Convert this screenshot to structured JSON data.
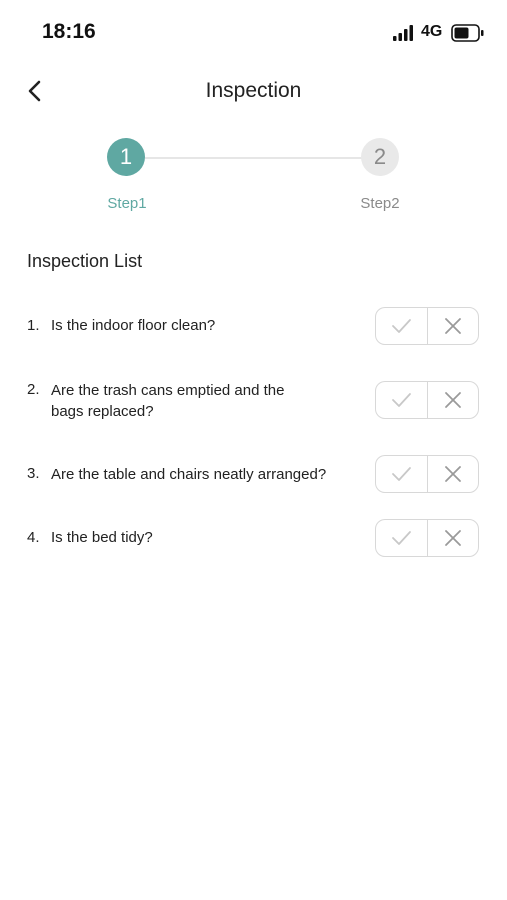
{
  "status_bar": {
    "time": "18:16",
    "network": "4G"
  },
  "header": {
    "title": "Inspection",
    "back_icon": "chevron-left-icon"
  },
  "stepper": {
    "steps": [
      {
        "number": "1",
        "label": "Step1",
        "active": true
      },
      {
        "number": "2",
        "label": "Step2",
        "active": false
      }
    ],
    "active_color": "#5fa8a2",
    "inactive_color": "#e9e9e9"
  },
  "inspection_list": {
    "title": "Inspection List",
    "items": [
      {
        "number": "1.",
        "text": "Is the indoor floor clean?"
      },
      {
        "number": "2.",
        "text": "Are the trash cans emptied and the bags replaced?"
      },
      {
        "number": "3.",
        "text": "Are the table and chairs neatly arranged?"
      },
      {
        "number": "4.",
        "text": "Is the bed tidy?"
      }
    ],
    "yes_icon": "checkmark-icon",
    "no_icon": "cross-icon"
  }
}
